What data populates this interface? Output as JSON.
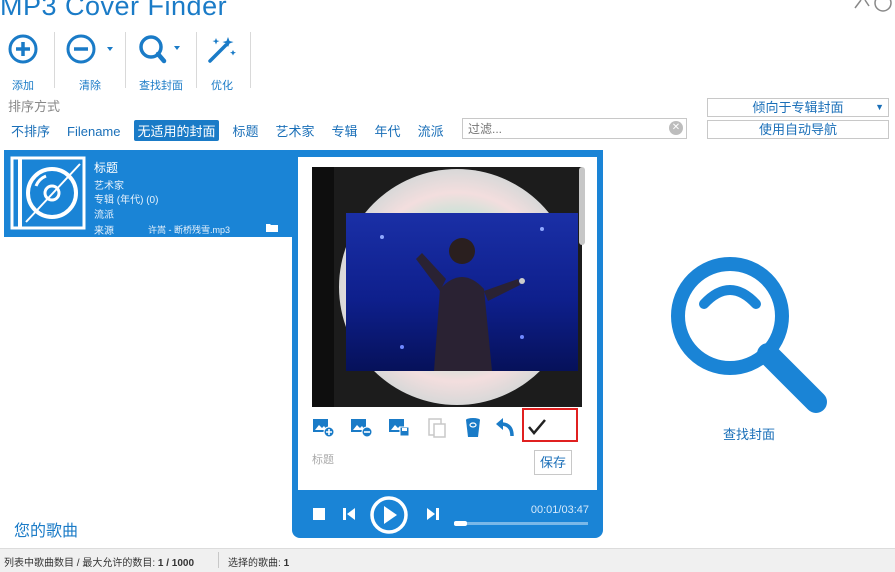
{
  "app": {
    "title": "MP3 Cover Finder"
  },
  "toolbar": {
    "add_label": "添加",
    "clear_label": "清除",
    "find_cover_label": "查找封面",
    "optimize_label": "优化"
  },
  "sort": {
    "title": "排序方式",
    "options": [
      "不排序",
      "Filename",
      "无适用的封面",
      "标题",
      "艺术家",
      "专辑",
      "年代",
      "流派"
    ],
    "active": "无适用的封面"
  },
  "filter": {
    "placeholder": "过滤..."
  },
  "right_controls": {
    "prefer_select": "倾向于专辑封面",
    "auto_nav_button": "使用自动导航"
  },
  "song": {
    "title": "标题",
    "artist": "艺术家",
    "album": "专辑 (年代)  (0)",
    "genre": "流派",
    "source_label": "来源",
    "filename": "许嵩 - 断桥残雪.mp3"
  },
  "cover_editor": {
    "title_label": "标题",
    "save_button": "保存"
  },
  "player": {
    "time": "00:01/03:47",
    "progress": 0.1
  },
  "search_area": {
    "label": "查找封面"
  },
  "footer": {
    "your_songs": "您的歌曲",
    "count_label": "列表中歌曲数目 / 最大允许的数目: ",
    "count_value": "1 / 1000",
    "selected_label": "选择的歌曲: ",
    "selected_value": "1"
  },
  "colors": {
    "accent": "#1a84d6",
    "highlight": "#e02020"
  }
}
